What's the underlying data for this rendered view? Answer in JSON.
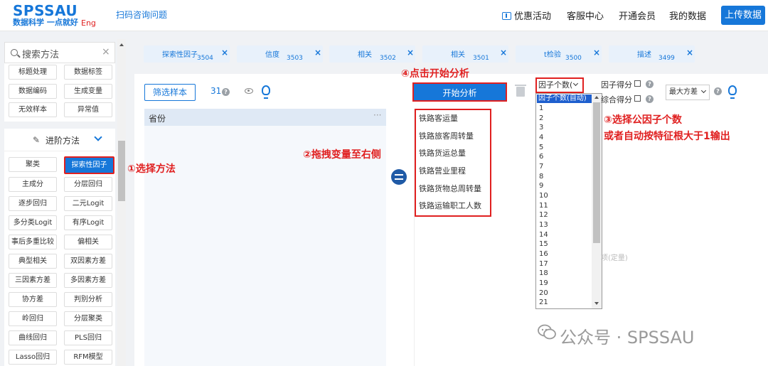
{
  "header": {
    "logo": "SPSSAU",
    "slogan": "数据科学 一点就好",
    "lang": "Eng",
    "qr_link": "扫码咨询问题",
    "nav": [
      {
        "label": "优惠活动",
        "icon": "gift-icon"
      },
      {
        "label": "客服中心"
      },
      {
        "label": "开通会员"
      },
      {
        "label": "我的数据"
      }
    ],
    "upload": "上传数据"
  },
  "sidebar": {
    "search_placeholder": "搜索方法",
    "close": "×",
    "basic_methods": [
      "标题处理",
      "数据标签",
      "数据编码",
      "生成变量",
      "无效样本",
      "异常值"
    ],
    "advanced_title": "进阶方法",
    "advanced_methods": [
      "聚类",
      "探索性因子",
      "主成分",
      "分层回归",
      "逐步回归",
      "二元Logit",
      "多分类Logit",
      "有序Logit",
      "事后多重比较",
      "偏相关",
      "典型相关",
      "双因素方差",
      "三因素方差",
      "多因素方差",
      "协方差",
      "判别分析",
      "岭回归",
      "分层聚类",
      "曲线回归",
      "PLS回归",
      "Lasso回归",
      "RFM模型"
    ],
    "active_method": "探索性因子"
  },
  "tabs": [
    {
      "label": "探索性因子",
      "num": "3504"
    },
    {
      "label": "信度",
      "num": "3503"
    },
    {
      "label": "相关",
      "num": "3502"
    },
    {
      "label": "相关",
      "num": "3501"
    },
    {
      "label": "t检验",
      "num": "3500"
    },
    {
      "label": "描述",
      "num": "3499"
    }
  ],
  "toolbar": {
    "filter": "筛选样本",
    "count": "31",
    "start": "开始分析"
  },
  "left_list": {
    "header": "省份",
    "more": "···"
  },
  "right_list": {
    "items": [
      "铁路客运量",
      "铁路旅客周转量",
      "铁路货运总量",
      "铁路营业里程",
      "铁路货物总周转量",
      "铁路运输职工人数"
    ]
  },
  "factor_select": {
    "value": "因子个数(",
    "options": [
      "因子个数(自动)",
      "1",
      "2",
      "3",
      "4",
      "5",
      "6",
      "7",
      "8",
      "9",
      "10",
      "11",
      "12",
      "13",
      "14",
      "15",
      "16",
      "17",
      "18",
      "19",
      "20",
      "21"
    ]
  },
  "options": {
    "factor_score": "因子得分",
    "composite_score": "综合得分",
    "rotation": "最大方差"
  },
  "ghost_text": "项(定量)",
  "annotations": {
    "a1": "①选择方法",
    "a2": "②拖拽变量至右侧",
    "a3_line1": "③选择公因子个数",
    "a3_line2": "或者自动按特征根大于1输出",
    "a4": "④点击开始分析"
  },
  "watermark": "公众号 · SPSSAU",
  "colors": {
    "primary": "#1677d9",
    "annotation": "#e02020",
    "selected": "#1e5fce"
  }
}
